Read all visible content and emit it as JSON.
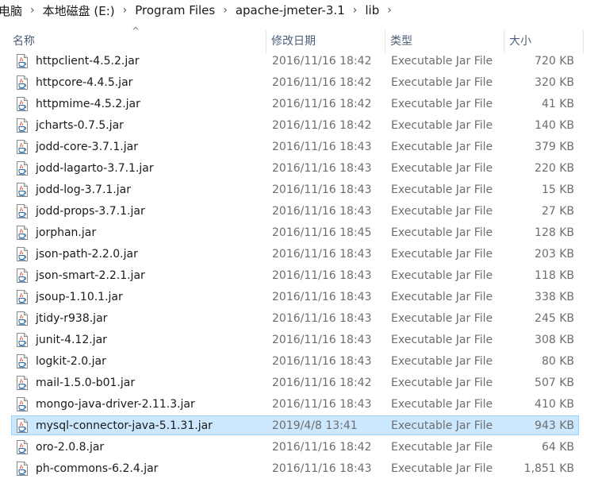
{
  "breadcrumb": {
    "items": [
      "电脑",
      "本地磁盘 (E:)",
      "Program Files",
      "apache-jmeter-3.1",
      "lib"
    ],
    "separator": "›"
  },
  "columns": {
    "name": "名称",
    "date": "修改日期",
    "type": "类型",
    "size": "大小"
  },
  "sort_indicator": "^",
  "selection_color": "#cce8ff",
  "file_icon": "java-jar-file-icon",
  "files": [
    {
      "name": "httpclient-4.5.2.jar",
      "date": "2016/11/16 18:42",
      "type": "Executable Jar File",
      "size": "720 KB"
    },
    {
      "name": "httpcore-4.4.5.jar",
      "date": "2016/11/16 18:42",
      "type": "Executable Jar File",
      "size": "320 KB"
    },
    {
      "name": "httpmime-4.5.2.jar",
      "date": "2016/11/16 18:42",
      "type": "Executable Jar File",
      "size": "41 KB"
    },
    {
      "name": "jcharts-0.7.5.jar",
      "date": "2016/11/16 18:42",
      "type": "Executable Jar File",
      "size": "140 KB"
    },
    {
      "name": "jodd-core-3.7.1.jar",
      "date": "2016/11/16 18:43",
      "type": "Executable Jar File",
      "size": "379 KB"
    },
    {
      "name": "jodd-lagarto-3.7.1.jar",
      "date": "2016/11/16 18:43",
      "type": "Executable Jar File",
      "size": "220 KB"
    },
    {
      "name": "jodd-log-3.7.1.jar",
      "date": "2016/11/16 18:43",
      "type": "Executable Jar File",
      "size": "15 KB"
    },
    {
      "name": "jodd-props-3.7.1.jar",
      "date": "2016/11/16 18:43",
      "type": "Executable Jar File",
      "size": "27 KB"
    },
    {
      "name": "jorphan.jar",
      "date": "2016/11/16 18:45",
      "type": "Executable Jar File",
      "size": "128 KB"
    },
    {
      "name": "json-path-2.2.0.jar",
      "date": "2016/11/16 18:43",
      "type": "Executable Jar File",
      "size": "203 KB"
    },
    {
      "name": "json-smart-2.2.1.jar",
      "date": "2016/11/16 18:43",
      "type": "Executable Jar File",
      "size": "118 KB"
    },
    {
      "name": "jsoup-1.10.1.jar",
      "date": "2016/11/16 18:43",
      "type": "Executable Jar File",
      "size": "338 KB"
    },
    {
      "name": "jtidy-r938.jar",
      "date": "2016/11/16 18:43",
      "type": "Executable Jar File",
      "size": "245 KB"
    },
    {
      "name": "junit-4.12.jar",
      "date": "2016/11/16 18:43",
      "type": "Executable Jar File",
      "size": "308 KB"
    },
    {
      "name": "logkit-2.0.jar",
      "date": "2016/11/16 18:43",
      "type": "Executable Jar File",
      "size": "80 KB"
    },
    {
      "name": "mail-1.5.0-b01.jar",
      "date": "2016/11/16 18:42",
      "type": "Executable Jar File",
      "size": "507 KB"
    },
    {
      "name": "mongo-java-driver-2.11.3.jar",
      "date": "2016/11/16 18:43",
      "type": "Executable Jar File",
      "size": "410 KB"
    },
    {
      "name": "mysql-connector-java-5.1.31.jar",
      "date": "2019/4/8 13:41",
      "type": "Executable Jar File",
      "size": "943 KB",
      "selected": true
    },
    {
      "name": "oro-2.0.8.jar",
      "date": "2016/11/16 18:42",
      "type": "Executable Jar File",
      "size": "64 KB"
    },
    {
      "name": "ph-commons-6.2.4.jar",
      "date": "2016/11/16 18:43",
      "type": "Executable Jar File",
      "size": "1,851 KB"
    }
  ]
}
